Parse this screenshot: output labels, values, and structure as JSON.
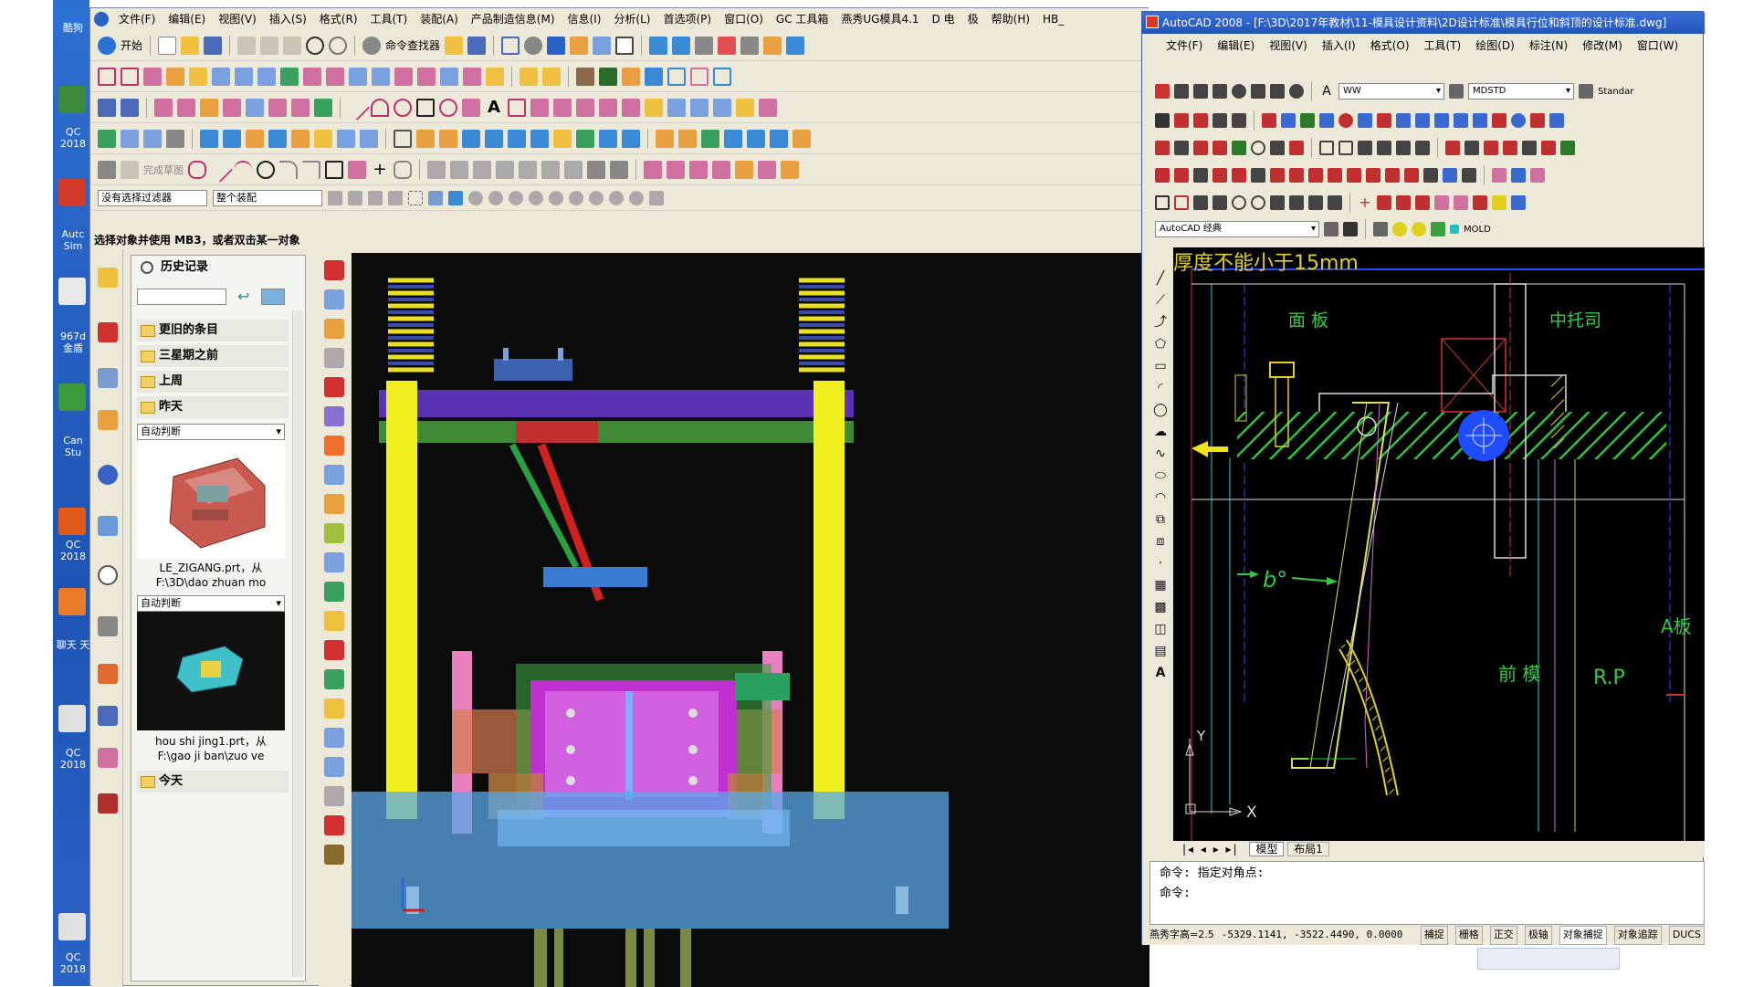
{
  "desktop": {
    "labels": [
      "酷狗",
      "QC 2018",
      "Autc Sim",
      "967d 金盾",
      "Can Stu",
      "QC 2018",
      "聊天 天",
      "QC 2018",
      "QC 2018"
    ]
  },
  "ug": {
    "menu": [
      "文件(F)",
      "编辑(E)",
      "视图(V)",
      "插入(S)",
      "格式(R)",
      "工具(T)",
      "装配(A)",
      "产品制造信息(M)",
      "信息(I)",
      "分析(L)",
      "首选项(P)",
      "窗口(O)",
      "GC 工具箱",
      "燕秀UG模具4.1",
      "D 电",
      "极",
      "帮助(H)",
      "HB_"
    ],
    "toolbar": {
      "start_label": "开始",
      "command_finder_label": "命令查找器",
      "filter_select": "没有选择过滤器",
      "assembly_select": "整个装配",
      "sketch_label": "完成草图"
    },
    "status_text": "选择对象并使用 MB3，或者双击某一对象",
    "history": {
      "title": "历史记录",
      "groups": [
        "更旧的条目",
        "三星期之前",
        "上周",
        "昨天"
      ],
      "dropdown1": "自动判断",
      "item1_caption": [
        "LE_ZIGANG.prt，从",
        "F:\\3D\\dao zhuan mo"
      ],
      "dropdown2": "自动判断",
      "item2_caption": [
        "hou shi jing1.prt，从",
        "F:\\gao ji ban\\zuo ve"
      ],
      "today": "今天"
    }
  },
  "acad": {
    "title": "AutoCAD 2008 - [F:\\3D\\2017年教材\\11-模具设计资料\\2D设计标准\\模具行位和斜顶的设计标准.dwg]",
    "menu": [
      "文件(F)",
      "编辑(E)",
      "视图(V)",
      "插入(I)",
      "格式(O)",
      "工具(T)",
      "绘图(D)",
      "标注(N)",
      "修改(M)",
      "窗口(W)"
    ],
    "layer_select": "WW",
    "style_select": "MDSTD",
    "standard_label": "Standar",
    "workspace_select": "AutoCAD 经典",
    "layer_name": "MOLD",
    "drawing": {
      "heading": "厚度不能小于15mm",
      "label_panel": "面 板",
      "label_support": "中托司",
      "label_angle": "b°",
      "label_front_mold": "前 模",
      "label_rp": "R.P",
      "label_a_plate": "A板",
      "axis_x": "X",
      "axis_y": "Y"
    },
    "tabs": [
      "模型",
      "布局1"
    ],
    "command_lines": [
      "命令: 指定对角点:",
      "命令:"
    ],
    "status": {
      "font_height": "燕秀字高=2.5",
      "coords": "-5329.1141, -3522.4490, 0.0000",
      "buttons": [
        "捕捉",
        "栅格",
        "正交",
        "极轴",
        "对象捕捉",
        "对象追踪",
        "DUCS"
      ]
    }
  },
  "colors": {
    "acad_title": "#2354b8",
    "xp_blue": "#1e54b4",
    "ug_background": "#ece9d8",
    "cad_green": "#2ecc40",
    "cad_blue_highlight": "#1f4cff"
  }
}
